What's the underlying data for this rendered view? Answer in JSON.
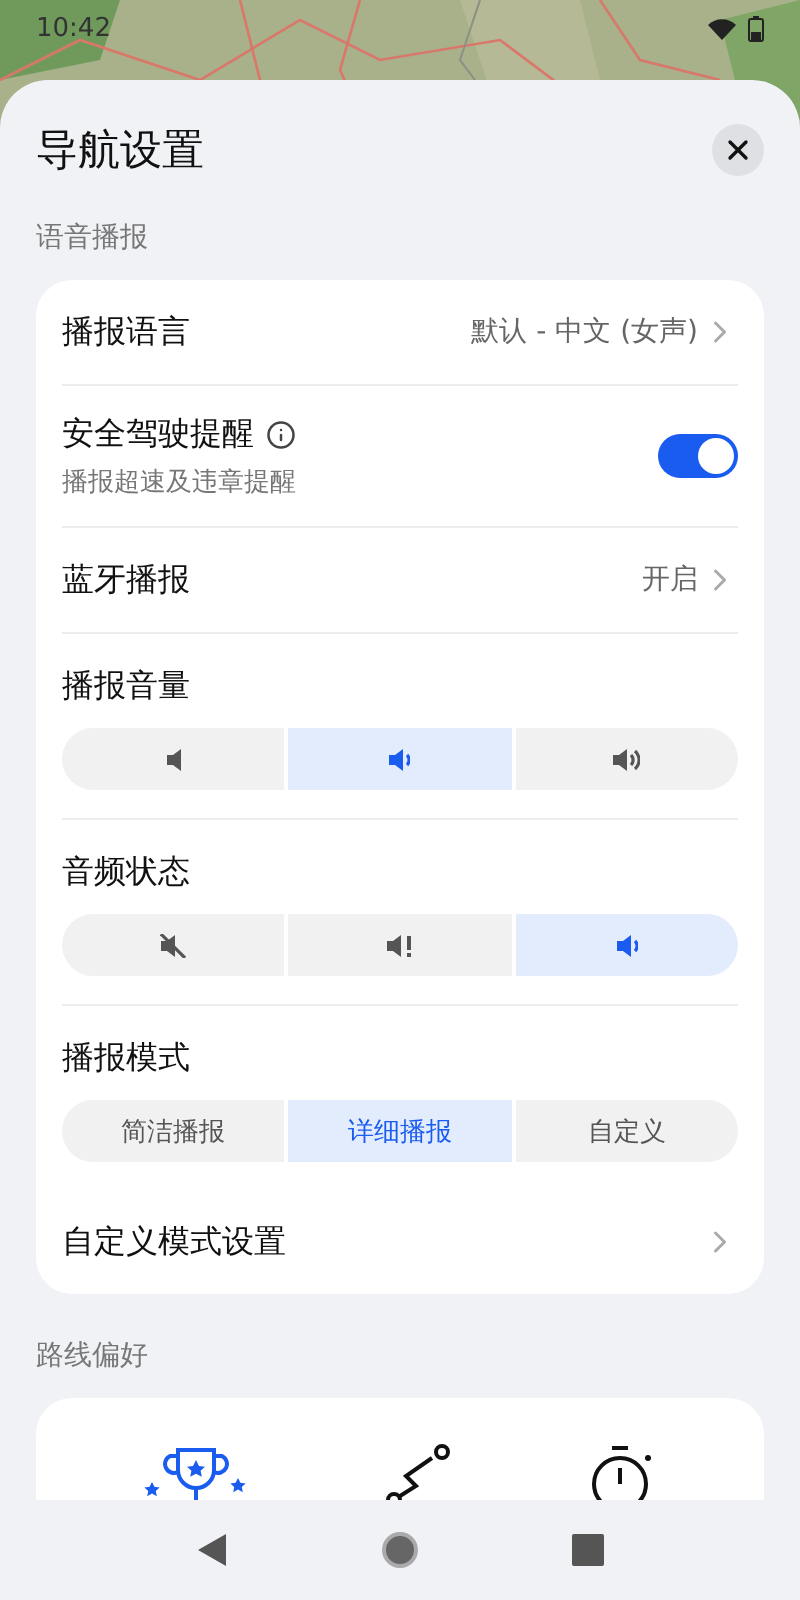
{
  "status_bar": {
    "time": "10:42"
  },
  "sheet": {
    "title": "导航设置"
  },
  "voice_section": {
    "heading": "语音播报",
    "rows": [
      {
        "kind": "link",
        "label": "播报语言",
        "value": "默认 - 中文 (女声)"
      },
      {
        "kind": "toggle",
        "label": "安全驾驶提醒",
        "info": true,
        "subtitle": "播报超速及违章提醒",
        "on": true
      },
      {
        "kind": "link",
        "label": "蓝牙播报",
        "value": "开启"
      },
      {
        "kind": "segmented",
        "label": "播报音量",
        "options": [
          {
            "kind": "volume-low",
            "selected": false
          },
          {
            "kind": "volume-mid",
            "selected": true
          },
          {
            "kind": "volume-high",
            "selected": false
          }
        ]
      },
      {
        "kind": "segmented",
        "label": "音频状态",
        "options": [
          {
            "kind": "muted",
            "selected": false
          },
          {
            "kind": "alert",
            "selected": false
          },
          {
            "kind": "volume-mid",
            "selected": true
          }
        ]
      },
      {
        "kind": "segmented",
        "label": "播报模式",
        "options": [
          {
            "kind": "text",
            "label": "简洁播报",
            "selected": false
          },
          {
            "kind": "text",
            "label": "详细播报",
            "selected": true
          },
          {
            "kind": "text",
            "label": "自定义",
            "selected": false
          }
        ]
      },
      {
        "kind": "link",
        "label": "自定义模式设置"
      }
    ]
  },
  "route_section": {
    "heading": "路线偏好",
    "options": [
      {
        "kind": "trophy",
        "selected": true
      },
      {
        "kind": "route",
        "selected": false
      },
      {
        "kind": "stopwatch",
        "selected": false
      }
    ]
  }
}
